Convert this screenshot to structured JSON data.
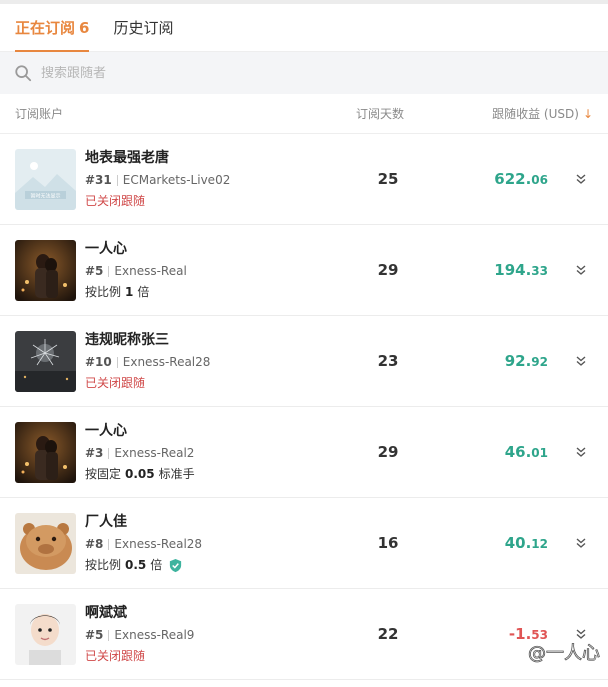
{
  "tabs": [
    {
      "label": "正在订阅",
      "count": "6"
    },
    {
      "label": "历史订阅"
    }
  ],
  "search": {
    "placeholder": "搜索跟随者"
  },
  "columns": {
    "account": "订阅账户",
    "days": "订阅天数",
    "profit": "跟随收益 (USD)"
  },
  "rows": [
    {
      "name": "地表最强老唐",
      "rank": "#31",
      "server": "ECMarkets-Live02",
      "status": "已关闭跟随",
      "days": "25",
      "profit_int": "622.",
      "profit_dec": "06",
      "avatar_text": "暂时无法显示"
    },
    {
      "name": "一人心",
      "rank": "#5",
      "server": "Exness-Real",
      "status_prefix": "按比例",
      "status_value": "1",
      "status_suffix": "倍",
      "days": "29",
      "profit_int": "194.",
      "profit_dec": "33"
    },
    {
      "name": "违规昵称张三",
      "rank": "#10",
      "server": "Exness-Real28",
      "status": "已关闭跟随",
      "days": "23",
      "profit_int": "92.",
      "profit_dec": "92"
    },
    {
      "name": "一人心",
      "rank": "#3",
      "server": "Exness-Real2",
      "status_prefix": "按固定",
      "status_value": "0.05",
      "status_suffix": "标准手",
      "days": "29",
      "profit_int": "46.",
      "profit_dec": "01"
    },
    {
      "name": "厂人佳",
      "rank": "#8",
      "server": "Exness-Real28",
      "status_prefix": "按比例",
      "status_value": "0.5",
      "status_suffix": "倍",
      "days": "16",
      "profit_int": "40.",
      "profit_dec": "12"
    },
    {
      "name": "啊斌斌",
      "rank": "#5",
      "server": "Exness-Real9",
      "status": "已关闭跟随",
      "days": "22",
      "profit_int": "-1.",
      "profit_dec": "53"
    }
  ],
  "watermark": "@一人心",
  "colors": {
    "accent": "#e8873f",
    "positive": "#2ea58b",
    "negative": "#e05555",
    "closed": "#d04a4a"
  }
}
